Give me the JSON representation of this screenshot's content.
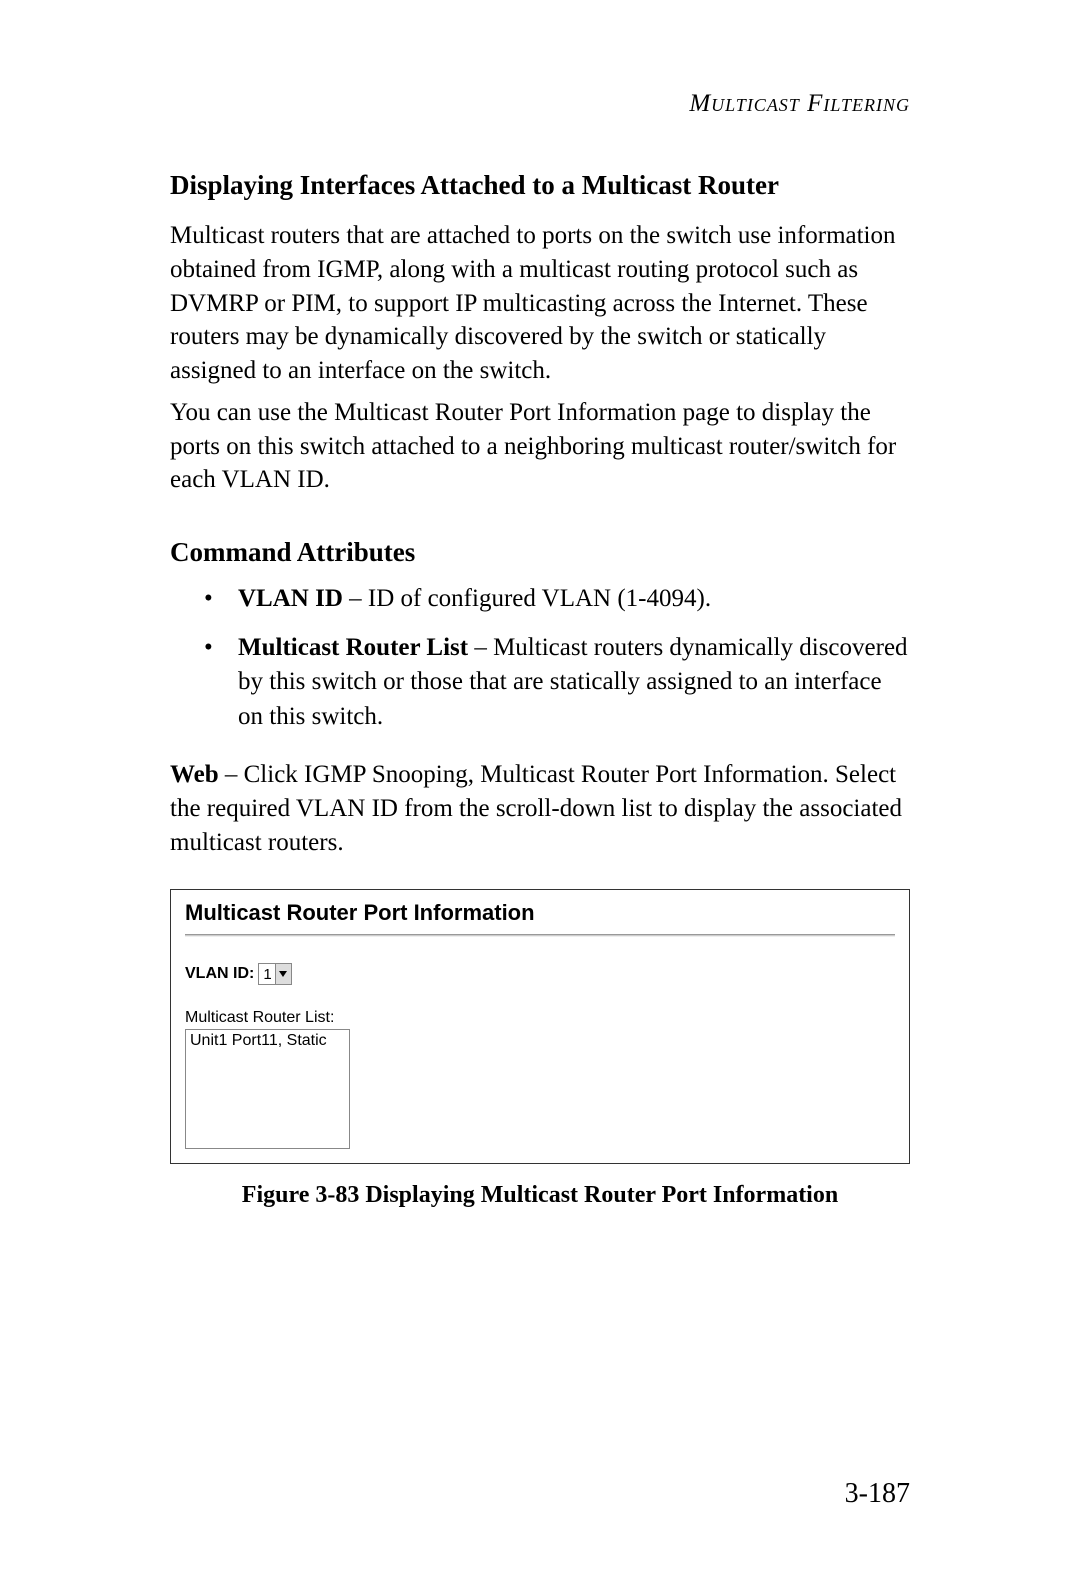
{
  "header": {
    "running": "Multicast Filtering"
  },
  "section": {
    "title": "Displaying Interfaces Attached to a Multicast Router",
    "para1": "Multicast routers that are attached to ports on the switch use information obtained from IGMP, along with a multicast routing protocol such as DVMRP or PIM, to support IP multicasting across the Internet. These routers may be dynamically discovered by the switch or statically assigned to an interface on the switch.",
    "para2": "You can use the Multicast Router Port Information page to display the ports on this switch attached to a neighboring multicast router/switch for each VLAN ID."
  },
  "attributes": {
    "title": "Command Attributes",
    "items": [
      {
        "label": "VLAN ID",
        "desc": " – ID of configured VLAN (1-4094)."
      },
      {
        "label": "Multicast Router List",
        "desc": " – Multicast routers dynamically discovered by this switch or those that are statically assigned to an interface on this switch."
      }
    ]
  },
  "web": {
    "label": "Web",
    "desc": " – Click IGMP Snooping, Multicast Router Port Information. Select the required VLAN ID from the scroll-down list to display the associated multicast routers."
  },
  "figure": {
    "panel_title": "Multicast Router Port Information",
    "vlan_label": "VLAN ID:",
    "vlan_value": "1",
    "list_label": "Multicast Router List:",
    "list_item": "Unit1 Port11, Static",
    "caption": "Figure 3-83  Displaying Multicast Router Port Information"
  },
  "page_number": "3-187"
}
